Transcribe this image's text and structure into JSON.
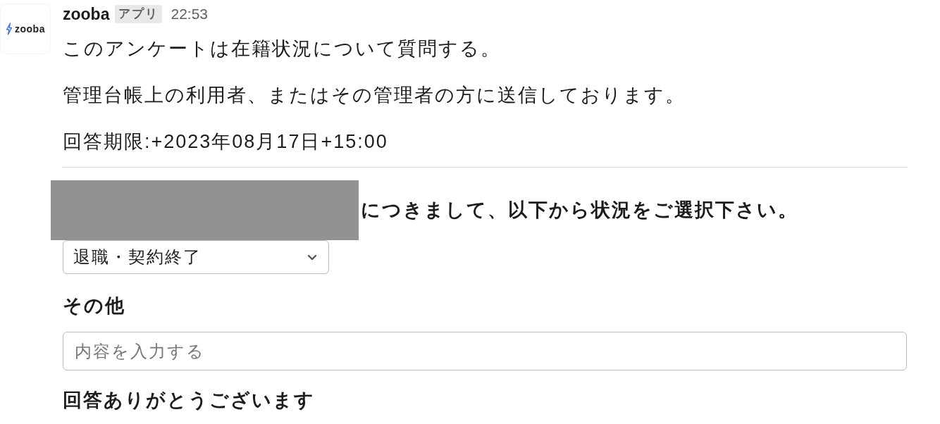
{
  "message": {
    "avatar": {
      "logo_text": "zooba"
    },
    "sender": "zooba",
    "badge": "アプリ",
    "time": "22:53",
    "paragraphs": [
      "このアンケートは在籍状況について質問する。",
      "管理台帳上の利用者、またはその管理者の方に送信しております。",
      "回答期限:+2023年08月17日+15:00"
    ]
  },
  "form": {
    "question": {
      "redacted": true,
      "text": "につきまして、以下から状況をご選択下さい。"
    },
    "select": {
      "value": "退職・契約終了"
    },
    "other": {
      "label": "その他",
      "placeholder": "内容を入力する"
    },
    "thanks": "回答ありがとうございます"
  }
}
